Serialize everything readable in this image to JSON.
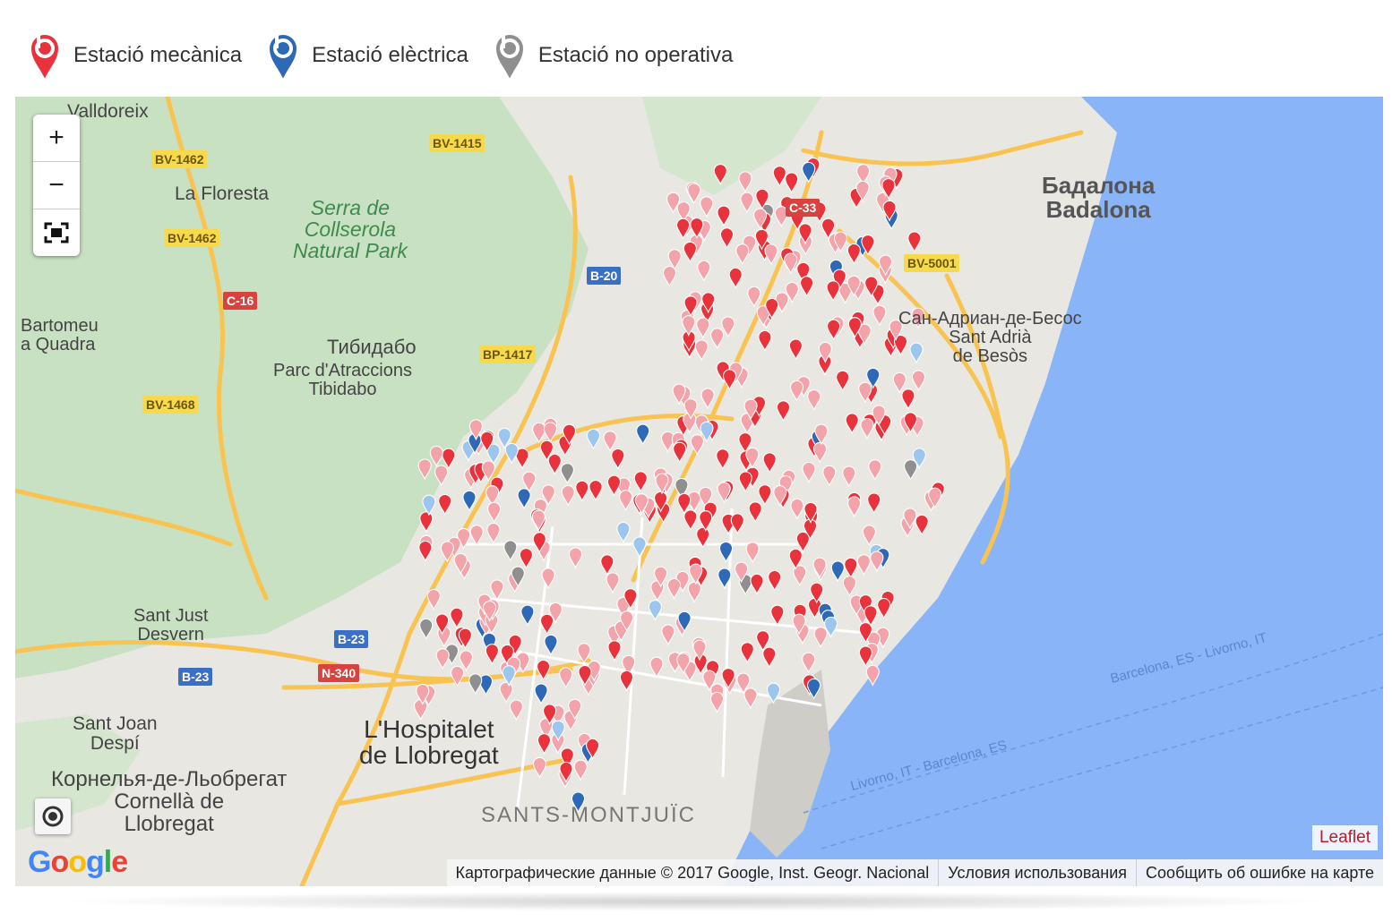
{
  "legend": [
    {
      "label": "Estació mecànica",
      "color": "#e8323c"
    },
    {
      "label": "Estació elèctrica",
      "color": "#2e69b8"
    },
    {
      "label": "Estació no operativa",
      "color": "#8f8f8f"
    }
  ],
  "controls": {
    "zoom_in": "+",
    "zoom_out": "−"
  },
  "places": {
    "valldoreix": "Valldoreix",
    "la_floresta": "La Floresta",
    "serra": "Serra de\nCollserola\nNatural Park",
    "bartomeu": "Bartomeu\na Quadra",
    "tibidabo_ru": "Тибидабо",
    "tibidabo": "Parc d'Atraccions\nTibidabo",
    "badalona": "Бадалона\nBadalona",
    "sant_adria": "Сан-Адриан-де-Бесос\nSant Adrià\nde Besòs",
    "sant_just": "Sant Just\nDesvern",
    "sant_joan": "Sant Joan\nDespí",
    "hospitalet": "L'Hospitalet\nde Llobregat",
    "cornella": "Корнелья-де-Льобрегат\nCornellà de\nLlobregat",
    "sants": "SANTS-MONTJUÏC",
    "route1": "Barcelona, ES - Livorno, IT",
    "route2": "Livorno, IT - Barcelona, ES"
  },
  "roads": {
    "bv1462a": "BV-1462",
    "bv1462b": "BV-1462",
    "bv1415": "BV-1415",
    "c16": "C-16",
    "b20": "B-20",
    "c33": "C-33",
    "bv5001": "BV-5001",
    "bp1417": "BP-1417",
    "bv1468": "BV-1468",
    "b23a": "B-23",
    "b23b": "B-23",
    "n340": "N-340"
  },
  "attribution": {
    "leaflet": "Leaflet",
    "data": "Картографические данные © 2017 Google, Inst. Geogr. Nacional",
    "terms": "Условия использования",
    "report": "Сообщить об ошибке на карте",
    "google": "Google"
  },
  "colors": {
    "mech": "#e8323c",
    "mech_light": "#f3a3aa",
    "elec": "#2e69b8",
    "elec_light": "#9cc6ee",
    "inactive": "#8f8f8f",
    "sea": "#8ab4f8",
    "land": "#e9e7e2",
    "park": "#c9e1c3",
    "road": "#f9c352"
  }
}
